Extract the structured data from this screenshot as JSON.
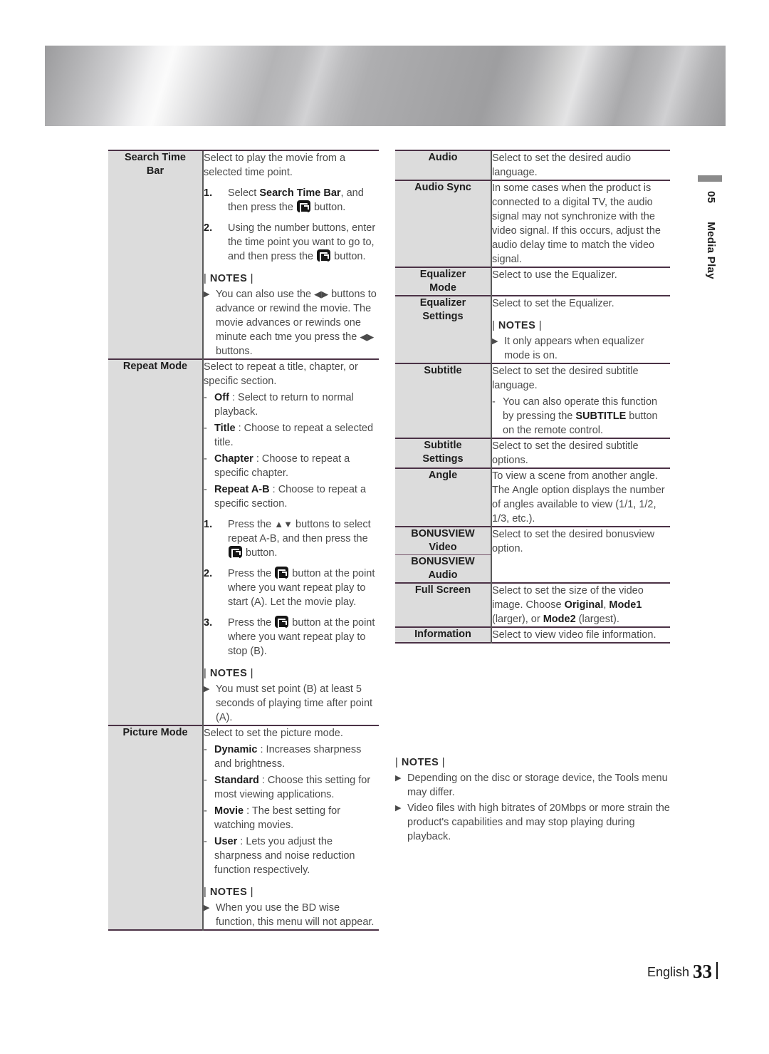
{
  "page": {
    "footer_language": "English",
    "footer_page_number": "33",
    "side_tab_number": "05",
    "side_tab_label": "Media Play"
  },
  "icons": {
    "enter_button": "enter-button-icon",
    "left_right_arrows": "◀▶",
    "up_down_arrows": "▲▼",
    "note_bullet": "▶"
  },
  "labels": {
    "notes_heading": "NOTES",
    "pipe": "|"
  },
  "left_table": {
    "rows": [
      {
        "label": "Search Time\nBar",
        "label_line1": "Search Time",
        "label_line2": "Bar",
        "intro": "Select to play the movie from a selected time point.",
        "steps": [
          {
            "n": "1.",
            "parts": [
              "Select ",
              "Search Time Bar",
              ", and then press the ",
              "ENTER",
              " button."
            ]
          },
          {
            "n": "2.",
            "parts": [
              "Using the number buttons, enter the time point you want to go to, and then press the ",
              "ENTER",
              " button."
            ]
          }
        ],
        "notes": [
          {
            "pre": "You can also use the ",
            "arrows": "◀▶",
            "post": " buttons to advance or rewind the movie. The movie advances or rewinds one minute each tme you press the ",
            "arrows2": "◀▶",
            "post2": " buttons."
          }
        ]
      },
      {
        "label_line1": "Repeat Mode",
        "label_line2": "",
        "intro": "Select to repeat a title, chapter, or specific section.",
        "dashes": [
          {
            "term": "Off",
            "text": " : Select to return to normal playback."
          },
          {
            "term": "Title",
            "text": " : Choose to repeat a selected title."
          },
          {
            "term": "Chapter",
            "text": " : Choose to repeat a specific chapter."
          },
          {
            "term": "Repeat A-B",
            "text": " : Choose to repeat a specific section."
          }
        ],
        "steps": [
          {
            "n": "1.",
            "pre": "Press the ",
            "arrows": "▲▼",
            "mid": " buttons to select repeat A-B, and then press the ",
            "post": " button."
          },
          {
            "n": "2.",
            "pre": "Press the ",
            "mid": " button at the point where you want repeat play to start (A). Let the movie play."
          },
          {
            "n": "3.",
            "pre": "Press the ",
            "mid": " button at the point where you want repeat play to stop (B)."
          }
        ],
        "notes": [
          {
            "text": "You must set point (B) at least 5 seconds of playing time after point (A)."
          }
        ]
      },
      {
        "label_line1": "Picture Mode",
        "label_line2": "",
        "intro": "Select to set the picture mode.",
        "dashes": [
          {
            "term": "Dynamic",
            "text": " : Increases sharpness and brightness."
          },
          {
            "term": "Standard",
            "text": " : Choose this setting for most viewing applications."
          },
          {
            "term": "Movie",
            "text": " : The best setting for watching movies."
          },
          {
            "term": "User",
            "text": " : Lets you adjust the sharpness and noise reduction function respectively."
          }
        ],
        "notes": [
          {
            "text": "When you use the BD wise function, this menu will not appear."
          }
        ]
      }
    ]
  },
  "right_table": {
    "rows": [
      {
        "label_line1": "Audio",
        "label_line2": "",
        "desc": "Select to set the desired audio language."
      },
      {
        "label_line1": "Audio Sync",
        "label_line2": "",
        "desc": "In some cases when the product is connected to a digital TV, the audio signal may not synchronize with the video signal. If this occurs, adjust the audio delay time to match the video signal."
      },
      {
        "label_line1": "Equalizer",
        "label_line2": "Mode",
        "desc": "Select to use the Equalizer."
      },
      {
        "label_line1": "Equalizer",
        "label_line2": "Settings",
        "desc": "Select to set the Equalizer.",
        "notes": [
          {
            "text": "It only appears when equalizer mode is on."
          }
        ]
      },
      {
        "label_line1": "Subtitle",
        "label_line2": "",
        "desc": "Select to set the desired subtitle language.",
        "dash_pre": "You can also operate this function by pressing the ",
        "dash_bold": "SUBTITLE",
        "dash_post": " button on the remote control."
      },
      {
        "label_line1": "Subtitle",
        "label_line2": "Settings",
        "desc": "Select to set the desired subtitle options."
      },
      {
        "label_line1": "Angle",
        "label_line2": "",
        "desc": "To view a scene from another angle. The Angle option displays the number of angles available to view (1/1, 1/2, 1/3, etc.)."
      },
      {
        "label_line1": "BONUSVIEW",
        "label_line2": "Video",
        "label2_line1": "BONUSVIEW",
        "label2_line2": "Audio",
        "desc": "Select to set the desired bonusview option."
      },
      {
        "label_line1": "Full Screen",
        "label_line2": "",
        "full_screen_pre": "Select to set the size of the video image. Choose ",
        "full_screen_b1": "Original",
        "full_screen_mid1": ", ",
        "full_screen_b2": "Mode1",
        "full_screen_mid2": " (larger), or ",
        "full_screen_b3": "Mode2",
        "full_screen_post": " (largest)."
      },
      {
        "label_line1": "Information",
        "label_line2": "",
        "desc": "Select to view video file information."
      }
    ]
  },
  "bottom_notes": {
    "heading": "NOTES",
    "items": [
      "Depending on the disc or storage device, the Tools menu may differ.",
      "Video files with high bitrates of 20Mbps or more strain the product's capabilities and may stop playing during playback."
    ]
  }
}
